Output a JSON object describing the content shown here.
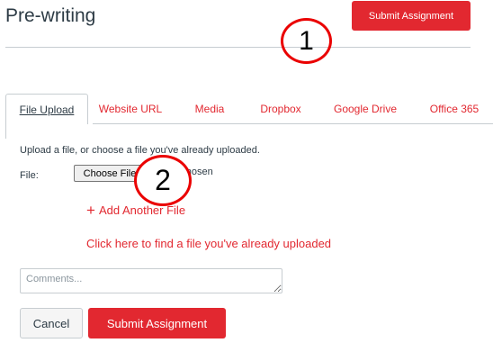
{
  "header": {
    "title": "Pre-writing",
    "submit_label": "Submit Assignment"
  },
  "tabs": [
    {
      "label": "File Upload",
      "active": true
    },
    {
      "label": "Website URL",
      "active": false
    },
    {
      "label": "Media",
      "active": false
    },
    {
      "label": "Dropbox",
      "active": false
    },
    {
      "label": "Google Drive",
      "active": false
    },
    {
      "label": "Office 365",
      "active": false
    }
  ],
  "upload": {
    "help_text": "Upload a file, or choose a file you've already uploaded.",
    "file_label": "File:",
    "choose_button": "Choose File",
    "no_file_text": "No file chosen",
    "add_another": "Add Another File",
    "find_link": "Click here to find a file you've already uploaded",
    "comments_placeholder": "Comments..."
  },
  "actions": {
    "cancel_label": "Cancel",
    "submit_label": "Submit Assignment"
  },
  "callouts": {
    "first": "1",
    "second": "2"
  },
  "colors": {
    "accent": "#e22830",
    "callout_ring": "#ea0000",
    "text": "#2d3b45",
    "border": "#c7cdd1"
  }
}
